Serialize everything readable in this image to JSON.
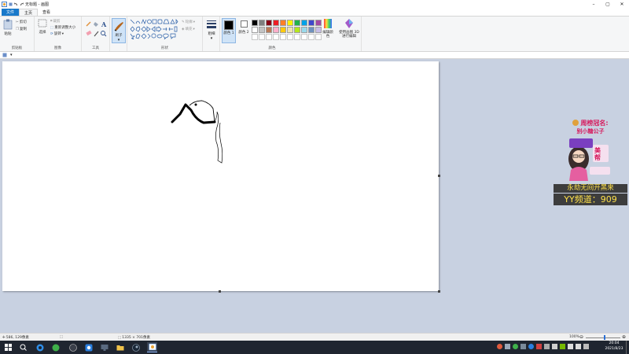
{
  "window": {
    "title": "无标题 - 画图"
  },
  "tabs": [
    {
      "label": "文件"
    },
    {
      "label": "主页"
    },
    {
      "label": "查看"
    }
  ],
  "ribbon": {
    "clipboard": {
      "paste": "粘贴",
      "cut": "剪切",
      "copy": "复制",
      "label": "剪贴板"
    },
    "image": {
      "select": "选择",
      "crop": "裁剪",
      "resize": "重新调整大小",
      "rotate": "旋转",
      "label": "图像"
    },
    "tools": {
      "label": "工具"
    },
    "brushes": {
      "label": "刷子"
    },
    "shapes": {
      "outline": "轮廓",
      "fill": "填充",
      "label": "形状"
    },
    "size": {
      "label": "粗细"
    },
    "colors": {
      "color1": "颜色 1",
      "color2": "颜色 2",
      "label": "颜色",
      "edit": "编辑颜色",
      "paint3d": "使用画图 3D 进行编辑",
      "color1_value": "#000000",
      "color2_value": "#ffffff",
      "palette_row1": [
        "#000000",
        "#7f7f7f",
        "#880015",
        "#ed1c24",
        "#ff7f27",
        "#fff200",
        "#22b14c",
        "#00a2e8",
        "#3f48cc",
        "#a349a4"
      ],
      "palette_row2": [
        "#ffffff",
        "#c3c3c3",
        "#b97a57",
        "#ffaec9",
        "#ffc90e",
        "#efe4b0",
        "#b5e61d",
        "#99d9ea",
        "#7092be",
        "#c8bfe7"
      ]
    }
  },
  "status": {
    "cursor": "586, 129像素",
    "canvas_size": "1335 × 701像素",
    "zoom": "100%"
  },
  "overlay": {
    "header": "周榜冠名:",
    "name": "别小糖公子",
    "line1": "永劫无间开黑来",
    "line2": "YY频道：909"
  },
  "taskbar": {
    "time": "20:04",
    "date": "2021/8/23"
  }
}
